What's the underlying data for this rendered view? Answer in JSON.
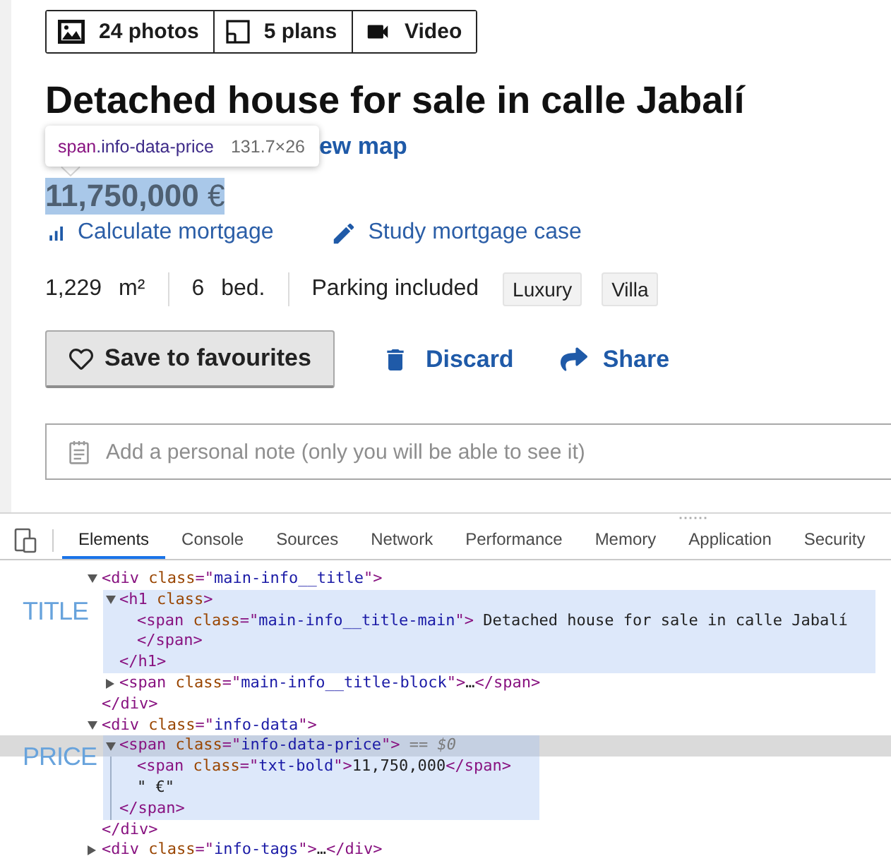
{
  "media_bar": [
    {
      "kind": "photos",
      "label": "24 photos"
    },
    {
      "kind": "plans",
      "label": "5 plans"
    },
    {
      "kind": "video",
      "label": "Video"
    }
  ],
  "title": "Detached house for sale in calle Jabalí",
  "inspect_tooltip": {
    "tag": "span",
    "class_name": ".info-data-price",
    "size": "131.7×26"
  },
  "map_link": "ew map",
  "price": {
    "text": "**11,750,000** €",
    "highlighted": true
  },
  "mortgage_links": [
    {
      "kind": "calculate",
      "label": "Calculate mortgage"
    },
    {
      "kind": "study",
      "label": "Study mortgage case"
    }
  ],
  "features": [
    {
      "value": "1,229",
      "unit": "m²"
    },
    {
      "value": "6",
      "unit": "bed."
    },
    {
      "value": "Parking included"
    }
  ],
  "tags": [
    "Luxury",
    "Villa"
  ],
  "actions": [
    {
      "kind": "save",
      "label": "Save to favourites"
    },
    {
      "kind": "discard",
      "label": "Discard"
    },
    {
      "kind": "share",
      "label": "Share"
    }
  ],
  "note_field": {
    "placeholder": "Add a personal note (only you will be able to see it)"
  },
  "devtools": {
    "tabs": [
      {
        "label": "Elements",
        "selected": true
      },
      {
        "label": "Console",
        "selected": false
      },
      {
        "label": "Sources",
        "selected": false
      },
      {
        "label": "Network",
        "selected": false
      },
      {
        "label": "Performance",
        "selected": false
      },
      {
        "label": "Memory",
        "selected": false
      },
      {
        "label": "Application",
        "selected": false
      },
      {
        "label": "Security",
        "selected": false
      }
    ],
    "elements_tree": [
      {
        "parts": [
          {
            "kind": "tag",
            "text": "<div"
          },
          {
            "kind": "attr",
            "text": " class"
          },
          {
            "kind": "tag",
            "text": "=\""
          },
          {
            "kind": "value",
            "text": "main-info__title"
          },
          {
            "kind": "tag",
            "text": "\">"
          }
        ],
        "expanded": true,
        "selected": false,
        "children": [
          {
            "parts": [
              {
                "kind": "tag",
                "text": "<h1"
              },
              {
                "kind": "attr",
                "text": " class"
              },
              {
                "kind": "tag",
                "text": ">"
              }
            ],
            "expanded": true,
            "selected": false,
            "annotation": "TITLE",
            "children": [
              {
                "parts": [
                  {
                    "kind": "tag",
                    "text": "<span"
                  },
                  {
                    "kind": "attr",
                    "text": " class"
                  },
                  {
                    "kind": "tag",
                    "text": "=\""
                  },
                  {
                    "kind": "value",
                    "text": "main-info__title-main"
                  },
                  {
                    "kind": "tag",
                    "text": "\">"
                  },
                  {
                    "kind": "text",
                    "text": " Detached house for sale in calle Jabalí"
                  }
                ],
                "selected": false,
                "close_parts": [
                  {
                    "kind": "tag",
                    "text": "</span>"
                  }
                ]
              }
            ],
            "close_parts": [
              {
                "kind": "tag",
                "text": "</h1>"
              }
            ]
          },
          {
            "parts": [
              {
                "kind": "tag",
                "text": "<span"
              },
              {
                "kind": "attr",
                "text": " class"
              },
              {
                "kind": "tag",
                "text": "=\""
              },
              {
                "kind": "value",
                "text": "main-info__title-block"
              },
              {
                "kind": "tag",
                "text": "\">"
              },
              {
                "kind": "text",
                "text": "…"
              },
              {
                "kind": "tag",
                "text": "</span>"
              }
            ],
            "expanded": false,
            "selected": false
          }
        ],
        "close_parts": [
          {
            "kind": "tag",
            "text": "</div>"
          }
        ]
      },
      {
        "parts": [
          {
            "kind": "tag",
            "text": "<div"
          },
          {
            "kind": "attr",
            "text": " class"
          },
          {
            "kind": "tag",
            "text": "=\""
          },
          {
            "kind": "value",
            "text": "info-data"
          },
          {
            "kind": "tag",
            "text": "\">"
          }
        ],
        "expanded": true,
        "selected": false,
        "children": [
          {
            "parts": [
              {
                "kind": "tag",
                "text": "<span"
              },
              {
                "kind": "attr",
                "text": " class"
              },
              {
                "kind": "tag",
                "text": "=\""
              },
              {
                "kind": "value",
                "text": "info-data-price"
              },
              {
                "kind": "tag",
                "text": "\">"
              },
              {
                "kind": "ref",
                "text": " == $0"
              }
            ],
            "expanded": true,
            "selected": true,
            "annotation": "PRICE",
            "children": [
              {
                "parts": [
                  {
                    "kind": "tag",
                    "text": "<span"
                  },
                  {
                    "kind": "attr",
                    "text": " class"
                  },
                  {
                    "kind": "tag",
                    "text": "=\""
                  },
                  {
                    "kind": "value",
                    "text": "txt-bold"
                  },
                  {
                    "kind": "tag",
                    "text": "\">"
                  },
                  {
                    "kind": "text",
                    "text": "11,750,000"
                  },
                  {
                    "kind": "tag",
                    "text": "</span>"
                  }
                ],
                "selected": false
              },
              {
                "parts": [
                  {
                    "kind": "text",
                    "text": "\" €\""
                  }
                ],
                "selected": false
              }
            ],
            "close_parts": [
              {
                "kind": "tag",
                "text": "</span>"
              }
            ]
          }
        ],
        "close_parts": [
          {
            "kind": "tag",
            "text": "</div>"
          }
        ]
      },
      {
        "parts": [
          {
            "kind": "tag",
            "text": "<div"
          },
          {
            "kind": "attr",
            "text": " class"
          },
          {
            "kind": "tag",
            "text": "=\""
          },
          {
            "kind": "value",
            "text": "info-tags"
          },
          {
            "kind": "tag",
            "text": "\">"
          },
          {
            "kind": "text",
            "text": "…"
          },
          {
            "kind": "tag",
            "text": "</div>"
          }
        ],
        "expanded": false,
        "selected": false
      }
    ]
  }
}
